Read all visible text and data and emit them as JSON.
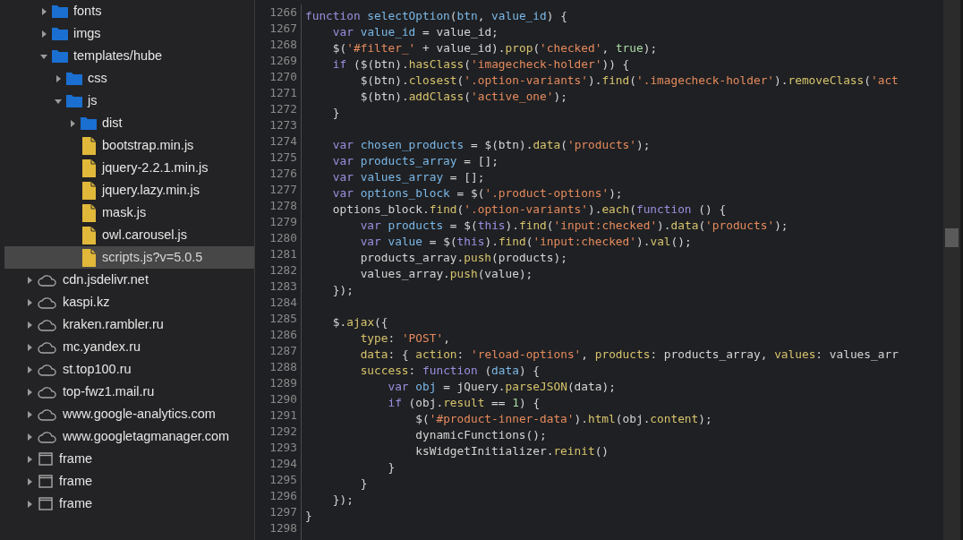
{
  "tree": {
    "continued_items": [
      {
        "kind": "folder",
        "name": "fonts",
        "expanded": false,
        "selected": false
      },
      {
        "kind": "folder",
        "name": "imgs",
        "expanded": false,
        "selected": false
      },
      {
        "kind": "folder",
        "name": "templates/hube",
        "expanded": true,
        "selected": false,
        "children": [
          {
            "kind": "folder",
            "name": "css",
            "expanded": false,
            "selected": false
          },
          {
            "kind": "folder",
            "name": "js",
            "expanded": true,
            "selected": false,
            "children": [
              {
                "kind": "folder",
                "name": "dist",
                "expanded": false,
                "selected": false
              },
              {
                "kind": "file",
                "name": "bootstrap.min.js",
                "selected": false
              },
              {
                "kind": "file",
                "name": "jquery-2.2.1.min.js",
                "selected": false
              },
              {
                "kind": "file",
                "name": "jquery.lazy.min.js",
                "selected": false
              },
              {
                "kind": "file",
                "name": "mask.js",
                "selected": false
              },
              {
                "kind": "file",
                "name": "owl.carousel.js",
                "selected": false
              },
              {
                "kind": "file",
                "name": "scripts.js?v=5.0.5",
                "selected": true
              }
            ]
          }
        ]
      }
    ],
    "items": [
      {
        "kind": "domain",
        "name": "cdn.jsdelivr.net",
        "expanded": false,
        "selected": false
      },
      {
        "kind": "domain",
        "name": "kaspi.kz",
        "expanded": false,
        "selected": false
      },
      {
        "kind": "domain",
        "name": "kraken.rambler.ru",
        "expanded": false,
        "selected": false
      },
      {
        "kind": "domain",
        "name": "mc.yandex.ru",
        "expanded": false,
        "selected": false
      },
      {
        "kind": "domain",
        "name": "st.top100.ru",
        "expanded": false,
        "selected": false
      },
      {
        "kind": "domain",
        "name": "top-fwz1.mail.ru",
        "expanded": false,
        "selected": false
      },
      {
        "kind": "domain",
        "name": "www.google-analytics.com",
        "expanded": false,
        "selected": false
      },
      {
        "kind": "domain",
        "name": "www.googletagmanager.com",
        "expanded": false,
        "selected": false
      },
      {
        "kind": "frame",
        "name": "frame",
        "expanded": false,
        "selected": false
      },
      {
        "kind": "frame",
        "name": "frame",
        "expanded": false,
        "selected": false
      },
      {
        "kind": "frame",
        "name": "frame",
        "expanded": false,
        "selected": false
      }
    ]
  },
  "editor": {
    "lines": [
      {
        "number": "1266",
        "text": "function selectOption(btn, value_id) {"
      },
      {
        "number": "1267",
        "text": "    var value_id = value_id;"
      },
      {
        "number": "1268",
        "text": "    $('#filter_' + value_id).prop('checked', true);"
      },
      {
        "number": "1269",
        "text": "    if ($(btn).hasClass('imagecheck-holder')) {"
      },
      {
        "number": "1270",
        "text": "        $(btn).closest('.option-variants').find('.imagecheck-holder').removeClass('act"
      },
      {
        "number": "1271",
        "text": "        $(btn).addClass('active_one');"
      },
      {
        "number": "1272",
        "text": "    }"
      },
      {
        "number": "1273"
      },
      {
        "number": "1274",
        "text": "    var chosen_products = $(btn).data('products');"
      },
      {
        "number": "1275",
        "text": "    var products_array = [];"
      },
      {
        "number": "1276",
        "text": "    var values_array = [];"
      },
      {
        "number": "1277",
        "text": "    var options_block = $('.product-options');"
      },
      {
        "number": "1278",
        "text": "    options_block.find('.option-variants').each(function () {"
      },
      {
        "number": "1279",
        "text": "        var products = $(this).find('input:checked').data('products');"
      },
      {
        "number": "1280",
        "text": "        var value = $(this).find('input:checked').val();"
      },
      {
        "number": "1281",
        "text": "        products_array.push(products);"
      },
      {
        "number": "1282",
        "text": "        values_array.push(value);"
      },
      {
        "number": "1283",
        "text": "    });"
      },
      {
        "number": "1284"
      },
      {
        "number": "1285",
        "text": "    $.ajax({"
      },
      {
        "number": "1286",
        "text": "        type: 'POST',"
      },
      {
        "number": "1287",
        "text": "        data: { action: 'reload-options', products: products_array, values: values_arr"
      },
      {
        "number": "1288",
        "text": "        success: function (data) {"
      },
      {
        "number": "1289",
        "text": "            var obj = jQuery.parseJSON(data);"
      },
      {
        "number": "1290",
        "text": "            if (obj.result == 1) {"
      },
      {
        "number": "1291",
        "text": "                $('#product-inner-data').html(obj.content);"
      },
      {
        "number": "1292",
        "text": "                dynamicFunctions();"
      },
      {
        "number": "1293",
        "text": "                ksWidgetInitializer.reinit()"
      },
      {
        "number": "1294",
        "text": "            }"
      },
      {
        "number": "1295",
        "text": "        }"
      },
      {
        "number": "1296",
        "text": "    });"
      },
      {
        "number": "1297",
        "text": "}"
      },
      {
        "number": "1298"
      }
    ]
  }
}
